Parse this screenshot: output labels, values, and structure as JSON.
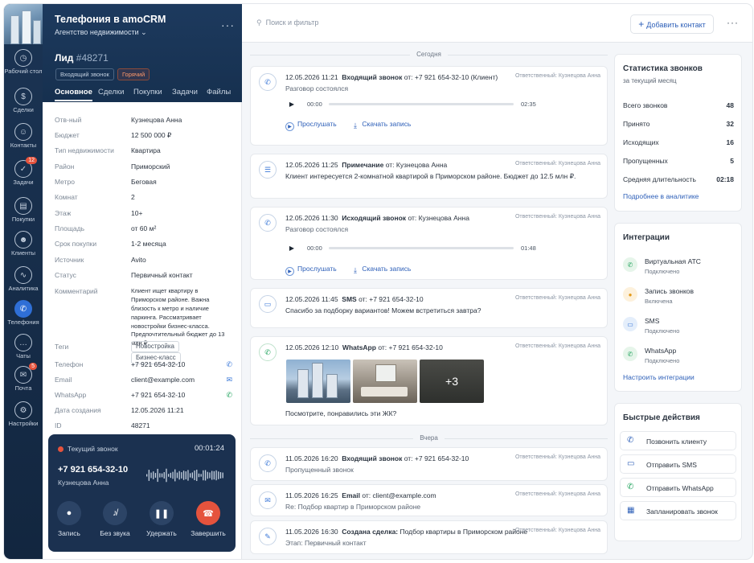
{
  "nav": {
    "items": [
      {
        "label": "Рабочий стол",
        "icon": "dashboard-icon",
        "glyph": "◷"
      },
      {
        "label": "Сделки",
        "icon": "dollar-icon",
        "glyph": "$"
      },
      {
        "label": "Контакты",
        "icon": "contact-icon",
        "glyph": "☺"
      },
      {
        "label": "Задачи",
        "icon": "tasks-icon",
        "glyph": "✓",
        "badge": "12"
      },
      {
        "label": "Покупки",
        "icon": "cart-icon",
        "glyph": "▤"
      },
      {
        "label": "Клиенты",
        "icon": "clients-icon",
        "glyph": "☻"
      },
      {
        "label": "Аналитика",
        "icon": "analytics-icon",
        "glyph": "∿"
      },
      {
        "label": "Телефония",
        "icon": "phone-icon",
        "glyph": "✆"
      },
      {
        "label": "Чаты",
        "icon": "chat-icon",
        "glyph": "…"
      },
      {
        "label": "Почта",
        "icon": "mail-icon",
        "glyph": "✉",
        "badge": "5"
      },
      {
        "label": "Настройки",
        "icon": "settings-icon",
        "glyph": "⚙"
      }
    ]
  },
  "account": {
    "title": "Телефония в amoCRM",
    "subtitle": "Агентство недвижимости"
  },
  "lead": {
    "label": "Лид",
    "number": "#48271",
    "tags": [
      "Входящий звонок",
      "Горячий"
    ],
    "tabs": [
      "Основное",
      "Сделки",
      "Покупки",
      "Задачи",
      "Файлы"
    ],
    "fields": [
      {
        "k": "Отв-ный",
        "v": "Кузнецова Анна"
      },
      {
        "k": "Бюджет",
        "v": "12 500 000 ₽"
      },
      {
        "k": "Тип недвижимости",
        "v": "Квартира"
      },
      {
        "k": "Район",
        "v": "Приморский"
      },
      {
        "k": "Метро",
        "v": "Беговая"
      },
      {
        "k": "Комнат",
        "v": "2"
      },
      {
        "k": "Этаж",
        "v": "10+"
      },
      {
        "k": "Площадь",
        "v": "от 60 м²"
      },
      {
        "k": "Срок покупки",
        "v": "1-2 месяца"
      },
      {
        "k": "Источник",
        "v": "Avito"
      },
      {
        "k": "Статус",
        "v": "Первичный контакт"
      },
      {
        "k": "Комментарий",
        "v": "Клиент ищет квартиру в Приморском районе. Важна близость к метро и наличие паркинга. Рассматривает новостройки бизнес-класса. Предпочтительный бюджет до 13 млн ₽."
      },
      {
        "k": "Теги",
        "chips": [
          "Новостройка",
          "Бизнес-класс"
        ]
      },
      {
        "k": "Телефон",
        "v": "+7 921 654-32-10"
      },
      {
        "k": "Email",
        "v": "client@example.com"
      },
      {
        "k": "WhatsApp",
        "v": "+7 921 654-32-10"
      },
      {
        "k": "Дата создания",
        "v": "12.05.2026 11:21"
      },
      {
        "k": "ID",
        "v": "48271"
      }
    ]
  },
  "call": {
    "label": "Текущий звонок",
    "timer": "00:01:24",
    "number": "+7 921 654-32-10",
    "name": "Кузнецова Анна",
    "buttons": [
      "Запись",
      "Без звука",
      "Удержать",
      "Завершить"
    ]
  },
  "topbar": {
    "search_placeholder": "Поиск и фильтр",
    "add_contact": "Добавить контакт"
  },
  "feed": {
    "today": "Сегодня",
    "yesterday": "Вчера",
    "responsible": "Ответственный: Кузнецова Анна",
    "from": "от:",
    "listen": "Прослушать",
    "download": "Скачать запись",
    "items": [
      {
        "time": "12.05.2026 11:21",
        "title": "Входящий звонок",
        "who": "+7 921 654-32-10 (Клиент)",
        "text": "Разговор состоялся",
        "t0": "00:00",
        "t1": "02:35"
      },
      {
        "time": "12.05.2026 11:25",
        "title": "Примечание",
        "who": "Кузнецова Анна",
        "text": "Клиент интересуется 2-комнатной квартирой в Приморском районе. Бюджет до 12.5 млн ₽."
      },
      {
        "time": "12.05.2026 11:30",
        "title": "Исходящий звонок",
        "who": "Кузнецова Анна",
        "text": "Разговор состоялся",
        "t0": "00:00",
        "t1": "01:48"
      },
      {
        "time": "12.05.2026 11:45",
        "title": "SMS",
        "who": "+7 921 654-32-10",
        "text": "Спасибо за подборку вариантов! Можем встретиться завтра?"
      },
      {
        "time": "12.05.2026 12:10",
        "title": "WhatsApp",
        "who": "+7 921 654-32-10",
        "text": "Посмотрите, понравились эти ЖК?",
        "more": "+3"
      },
      {
        "time": "11.05.2026 16:20",
        "title": "Входящий звонок",
        "who": "+7 921 654-32-10",
        "text": "Пропущенный звонок"
      },
      {
        "time": "11.05.2026 16:25",
        "title": "Email",
        "who": "client@example.com",
        "text": "Re: Подбор квартир в Приморском районе"
      },
      {
        "time": "11.05.2026 16:30",
        "title": "Создана сделка:",
        "who": "Подбор квартиры в Приморском районе",
        "text": "Этап: Первичный контакт"
      }
    ]
  },
  "stats": {
    "title": "Статистика звонков",
    "subtitle": "за текущий месяц",
    "rows": [
      {
        "k": "Всего звонков",
        "v": "48"
      },
      {
        "k": "Принято",
        "v": "32"
      },
      {
        "k": "Исходящих",
        "v": "16"
      },
      {
        "k": "Пропущенных",
        "v": "5"
      },
      {
        "k": "Средняя длительность",
        "v": "02:18"
      }
    ],
    "link": "Подробнее в аналитике"
  },
  "integrations": {
    "title": "Интеграции",
    "items": [
      {
        "name": "Виртуальная АТС",
        "status": "Подключено",
        "color": "#e6f5ea",
        "fg": "#25a560",
        "glyph": "✆"
      },
      {
        "name": "Запись звонков",
        "status": "Включена",
        "color": "#fdf1dc",
        "fg": "#e39a1b",
        "glyph": "●"
      },
      {
        "name": "SMS",
        "status": "Подключено",
        "color": "#e4eefb",
        "fg": "#2f6fd6",
        "glyph": "▭"
      },
      {
        "name": "WhatsApp",
        "status": "Подключено",
        "color": "#e6f5ea",
        "fg": "#25a560",
        "glyph": "✆"
      }
    ],
    "link": "Настроить интеграции"
  },
  "quick": {
    "title": "Быстрые действия",
    "items": [
      "Позвонить клиенту",
      "Отправить SMS",
      "Отправить WhatsApp",
      "Запланировать звонок"
    ]
  }
}
